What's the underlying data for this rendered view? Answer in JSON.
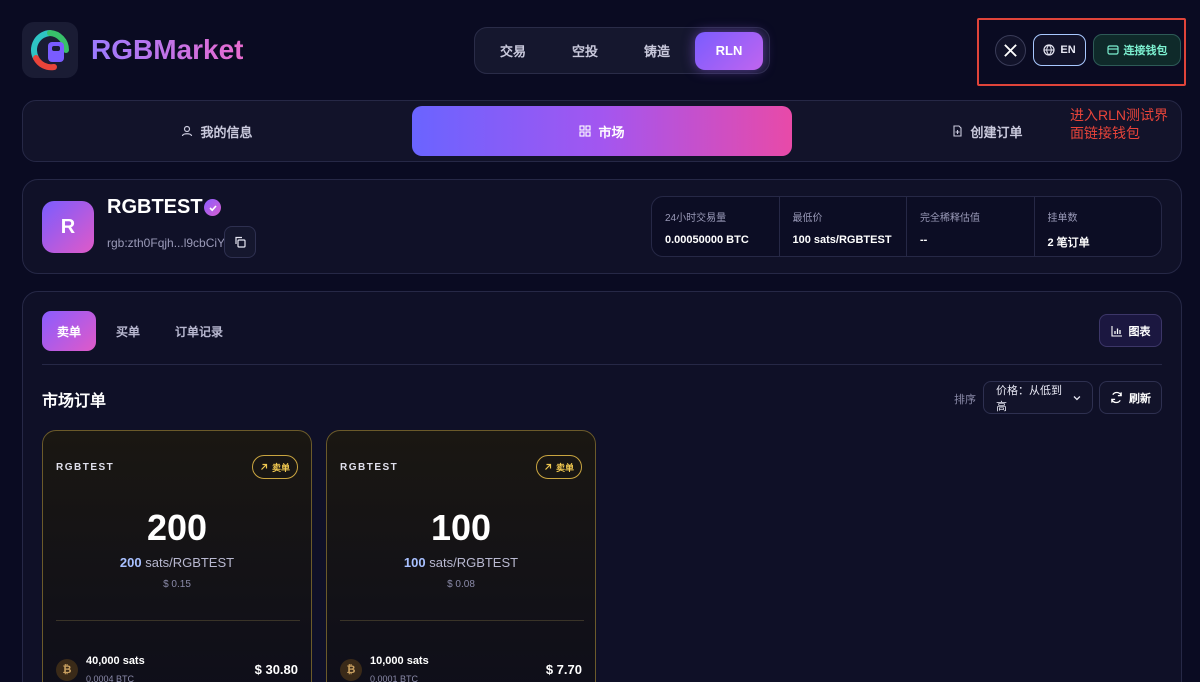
{
  "brand": {
    "name": "RGBMarket"
  },
  "topnav": {
    "tabs": [
      "交易",
      "空投",
      "铸造",
      "RLN"
    ],
    "active_index": 3
  },
  "header": {
    "language": "EN",
    "connect_wallet": "连接钱包"
  },
  "annotation": "进入RLN测试界面链接钱包",
  "section_tabs": {
    "profile": "我的信息",
    "market": "市场",
    "create_order": "创建订单"
  },
  "token": {
    "avatar_letter": "R",
    "name": "RGBTEST",
    "address": "rgb:zth0Fqjh...l9cbCiY"
  },
  "stats": [
    {
      "label": "24小时交易量",
      "value": "0.00050000 BTC"
    },
    {
      "label": "最低价",
      "value": "100 sats/RGBTEST"
    },
    {
      "label": "完全稀释估值",
      "value": "--"
    },
    {
      "label": "挂单数",
      "value": "2 笔订单"
    }
  ],
  "order_tabs": {
    "sell": "卖单",
    "buy": "买单",
    "history": "订单记录"
  },
  "chart_button": "图表",
  "market": {
    "title": "市场订单",
    "sort_label": "排序",
    "sort_value": "价格：从低到高",
    "refresh": "刷新"
  },
  "orders": [
    {
      "token": "RGBTEST",
      "badge": "卖单",
      "amount": "200",
      "price_num": "200",
      "price_unit": "sats/RGBTEST",
      "usd": "$ 0.15",
      "btc_icon": "₿",
      "sats": "40,000 sats",
      "btc": "0.0004 BTC",
      "total": "$ 30.80"
    },
    {
      "token": "RGBTEST",
      "badge": "卖单",
      "amount": "100",
      "price_num": "100",
      "price_unit": "sats/RGBTEST",
      "usd": "$ 0.08",
      "btc_icon": "₿",
      "sats": "10,000 sats",
      "btc": "0.0001 BTC",
      "total": "$ 7.70"
    }
  ],
  "colors": {
    "background": "#0a0b22",
    "accent_purple": "#8a5cff",
    "accent_pink": "#e05ac8",
    "annotation_red": "#e0443a",
    "sell_gold": "#f0c850"
  },
  "icons": {
    "x": "x-logo-icon",
    "globe": "globe-icon",
    "wallet": "wallet-icon",
    "user": "user-icon",
    "grid": "grid-icon",
    "file_plus": "file-plus-icon",
    "verified": "check-badge-icon",
    "copy": "copy-icon",
    "chart": "bar-chart-icon",
    "refresh": "refresh-icon",
    "chevron": "chevron-down-icon",
    "arrow": "arrow-up-right-icon",
    "btc": "bitcoin-icon"
  }
}
